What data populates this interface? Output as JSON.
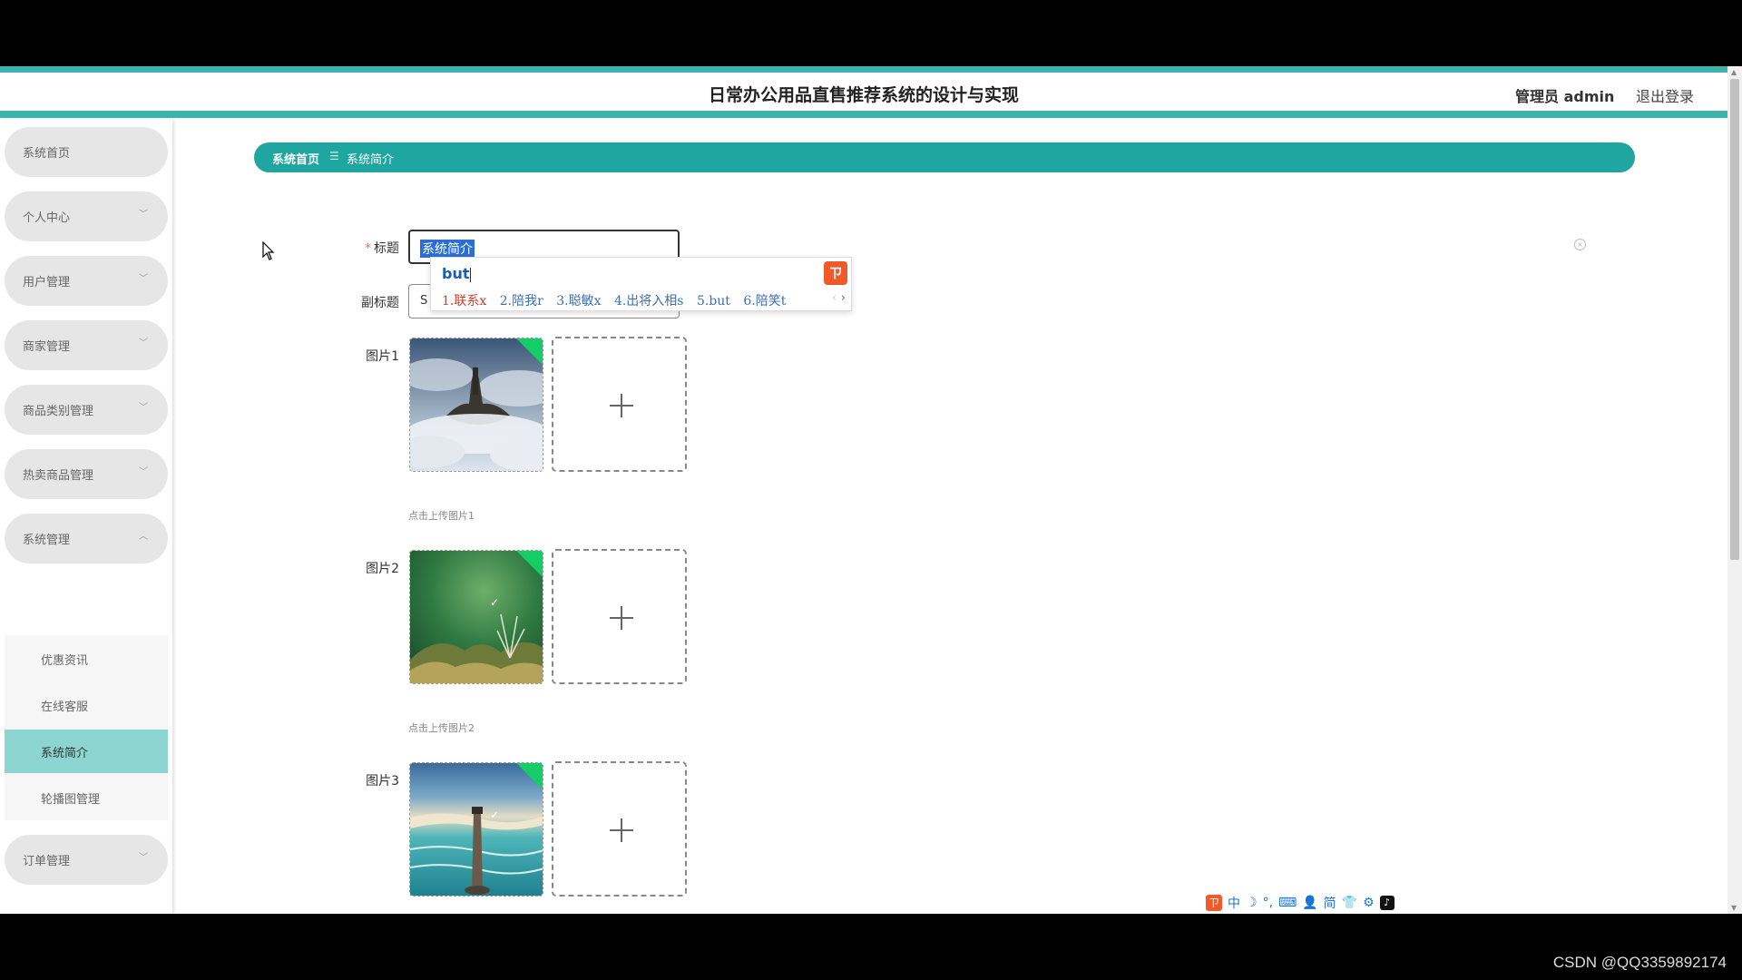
{
  "header": {
    "title": "日常办公用品直售推荐系统的设计与实现",
    "user": "管理员 admin",
    "logout": "退出登录"
  },
  "sidebar": {
    "items": [
      {
        "label": "系统首页",
        "arrow": ""
      },
      {
        "label": "个人中心",
        "arrow": "﹀"
      },
      {
        "label": "用户管理",
        "arrow": "﹀"
      },
      {
        "label": "商家管理",
        "arrow": "﹀"
      },
      {
        "label": "商品类别管理",
        "arrow": "﹀"
      },
      {
        "label": "热卖商品管理",
        "arrow": "﹀"
      },
      {
        "label": "系统管理",
        "arrow": "︿"
      },
      {
        "label": "订单管理",
        "arrow": "﹀"
      }
    ],
    "submenu": [
      {
        "label": "优惠资讯"
      },
      {
        "label": "在线客服"
      },
      {
        "label": "系统简介",
        "active": true
      },
      {
        "label": "轮播图管理"
      }
    ]
  },
  "breadcrumb": {
    "home": "系统首页",
    "separator": "☰",
    "current": "系统简介"
  },
  "form": {
    "title_label": "标题",
    "title_required": "*",
    "title_value": "系统简介",
    "subtitle_label": "副标题",
    "subtitle_value": "S",
    "images": [
      {
        "label": "图片1",
        "hint": "点击上传图片1"
      },
      {
        "label": "图片2",
        "hint": "点击上传图片2"
      },
      {
        "label": "图片3",
        "hint": ""
      }
    ],
    "upload_plus": "+"
  },
  "ime": {
    "input": "but",
    "candidates": [
      "1.联系x",
      "2.陪我r",
      "3.聪敏x",
      "4.出将入相s",
      "5.but",
      "6.陪笑t"
    ],
    "prev": "‹",
    "next": "›",
    "logo": "ㄗ"
  },
  "ime_toolbar": {
    "items": [
      "中",
      "☽",
      "°,",
      "⌨",
      "👤",
      "简",
      "👕",
      "⚙"
    ],
    "douyin": "♪"
  },
  "watermark": "CSDN @QQ3359892174",
  "colors": {
    "teal": "#1fa6a0",
    "teal_light": "#8dd5d0",
    "badge_green": "#13ce66"
  }
}
